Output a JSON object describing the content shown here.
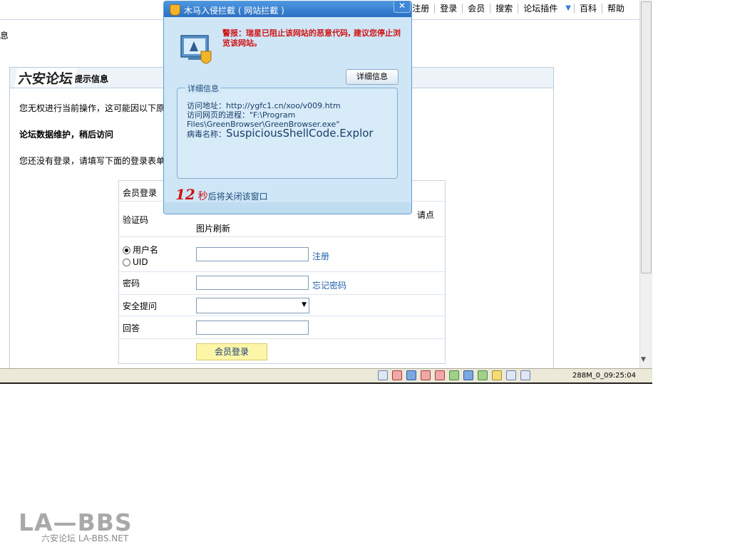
{
  "nav": {
    "items": [
      "注册",
      "登录",
      "会员",
      "搜索",
      "论坛插件",
      "百科",
      "帮助"
    ],
    "dropdown_arrow": "chevron-down-icon"
  },
  "left_fragment": "息",
  "panel": {
    "logo_text": "六安论坛",
    "title": "提示信息",
    "message1": "您无权进行当前操作，这可能因以下原",
    "message2": "论坛数据维护，稍后访问",
    "message3": "您还没有登录，请填写下面的登录表单"
  },
  "login": {
    "header": "会员登录",
    "captcha_label": "验证码",
    "captcha_hint": "请点",
    "captcha_refresh": "图片刷新",
    "username_option": "用户名",
    "uid_option": "UID",
    "register_link": "注册",
    "password_label": "密码",
    "forgot_link": "忘记密码",
    "question_label": "安全提问",
    "answer_label": "回答",
    "submit_label": "会员登录"
  },
  "statusbar": {
    "memory_time": "288M_0_09:25:04"
  },
  "popup": {
    "title": "木马入侵拦截 ( 网站拦截 )",
    "close": "✕",
    "warning": "警报：瑞星已阻止该网站的恶意代码, 建议您停止浏览该网站。",
    "detail_button": "详细信息",
    "detail_legend": "详细信息",
    "visit_label": "访问地址：",
    "visit_url": "http://ygfc1.cn/xoo/v009.htm",
    "process_label": "访问网页的进程：",
    "process_path": "\"F:\\Program Files\\GreenBrowser\\GreenBrowser.exe\"",
    "virus_label": "病毒名称：",
    "virus_name": "SuspiciousShellCode.Explor",
    "countdown_number": "12",
    "countdown_unit": "秒",
    "countdown_text": "后将关闭该窗口"
  },
  "watermark": {
    "big": "LA—BBS",
    "small": "六安论坛 LA-BBS.NET"
  },
  "colors": {
    "warning_red": "#d11414",
    "popup_bg": "#cfe6f7",
    "title_blue": "#2b6fc2",
    "link_blue": "#1f5fa8",
    "submit_yellow": "#fdf6a8"
  }
}
